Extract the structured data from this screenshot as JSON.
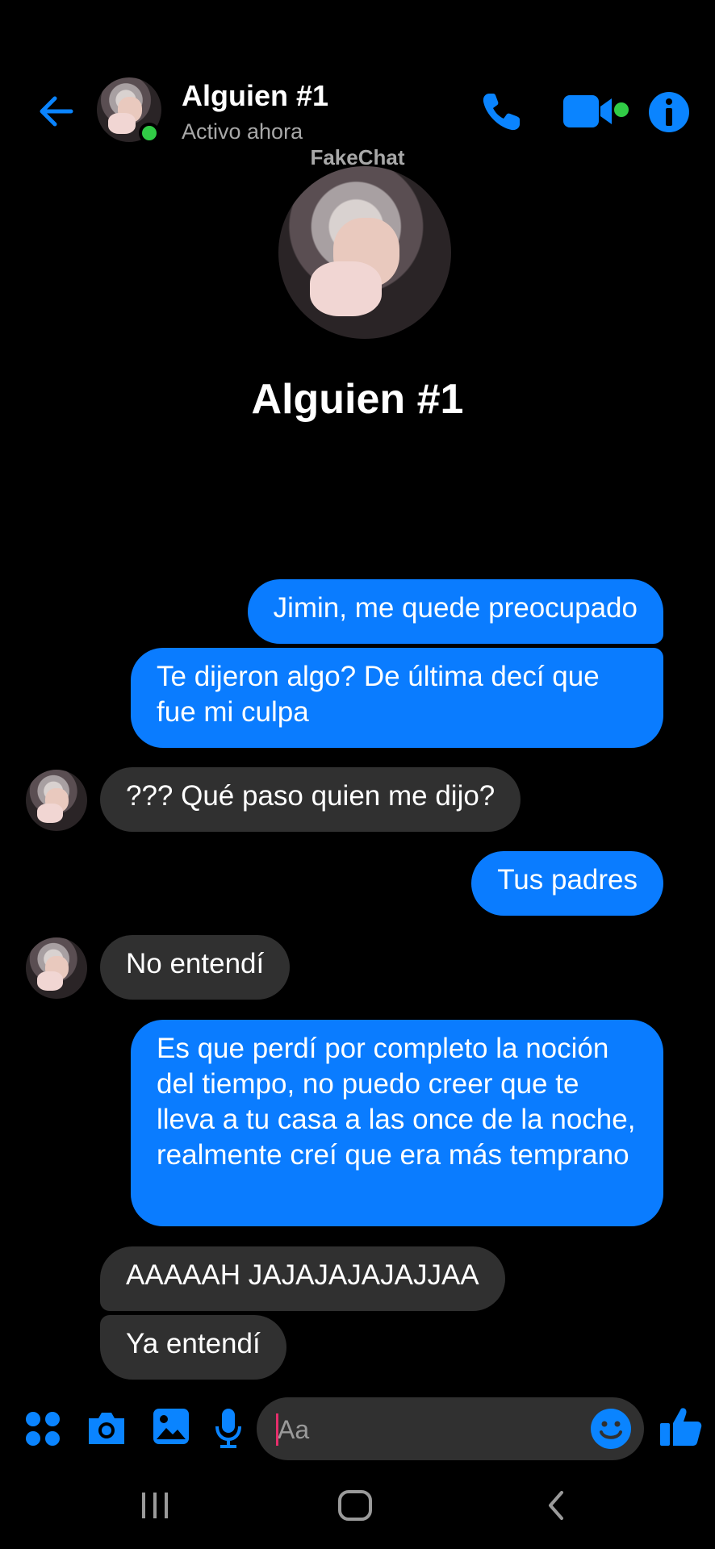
{
  "header": {
    "contact_name": "Alguien #1",
    "status": "Activo ahora",
    "icons": [
      "back-arrow-icon",
      "phone-icon",
      "video-camera-icon",
      "info-icon"
    ]
  },
  "watermark": "FakeChat",
  "profile": {
    "name": "Alguien #1"
  },
  "messages": [
    {
      "from": "me",
      "text": "Jimin, me quede preocupado"
    },
    {
      "from": "me",
      "text": "Te dijeron algo? De última decí que fue mi culpa"
    },
    {
      "from": "them",
      "text": "??? Qué paso quien me dijo?"
    },
    {
      "from": "me",
      "text": "Tus padres"
    },
    {
      "from": "them",
      "text": "No entendí"
    },
    {
      "from": "me",
      "text": "Es que perdí por completo la noción del tiempo, no puedo creer que te lleva a tu casa a las once de la noche, realmente creí que era más temprano"
    },
    {
      "from": "them",
      "text": "AAAAAH JAJAJAJAJAJJAA"
    },
    {
      "from": "them",
      "text": "Ya entendí"
    }
  ],
  "composer": {
    "placeholder": "Aa",
    "icons": [
      "apps-grid-icon",
      "camera-icon",
      "gallery-icon",
      "microphone-icon",
      "emoji-icon",
      "thumbs-up-icon"
    ]
  },
  "navbar": {
    "icons": [
      "recent-apps-icon",
      "home-icon",
      "back-nav-icon"
    ]
  },
  "colors": {
    "accent": "#0a7cff",
    "sent_bubble": "#0a7cff",
    "received_bubble": "#303030",
    "online": "#31cc46",
    "background": "#000000"
  }
}
